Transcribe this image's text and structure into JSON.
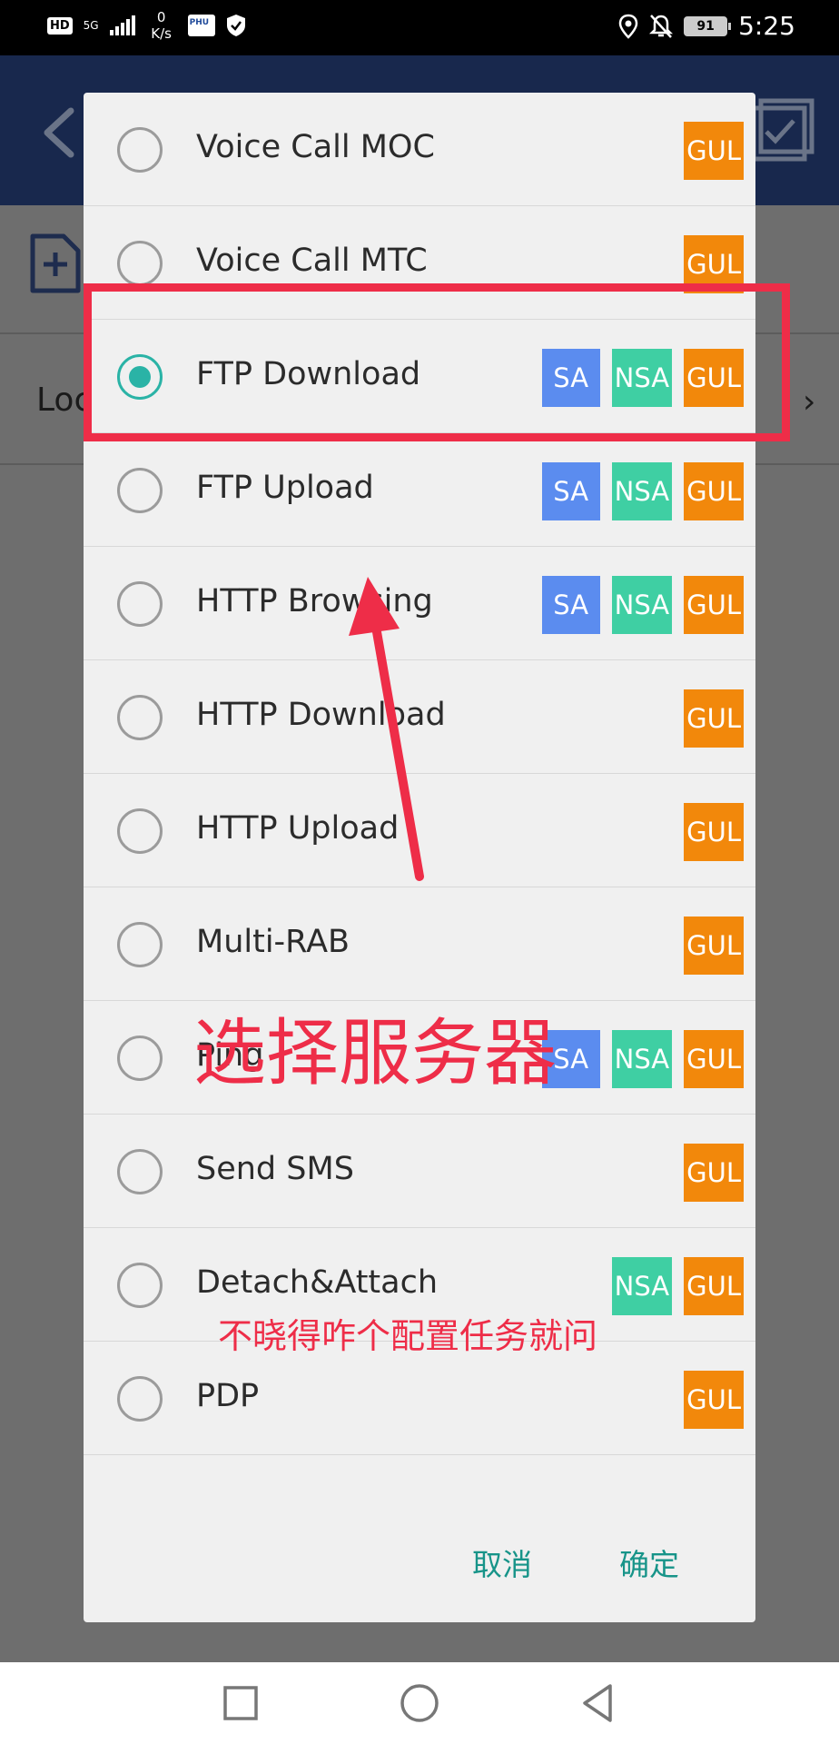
{
  "status_bar": {
    "hd": "HD",
    "network": "5G",
    "speed_value": "0",
    "speed_unit": "K/s",
    "app_badge": "PHU",
    "battery": "91",
    "time": "5:25"
  },
  "background": {
    "row_label_partial": "Loc"
  },
  "dialog": {
    "items": [
      {
        "label": "Voice Call MOC",
        "selected": false,
        "badges": [
          "GUL"
        ]
      },
      {
        "label": "Voice Call MTC",
        "selected": false,
        "badges": [
          "GUL"
        ]
      },
      {
        "label": "FTP Download",
        "selected": true,
        "badges": [
          "SA",
          "NSA",
          "GUL"
        ]
      },
      {
        "label": "FTP Upload",
        "selected": false,
        "badges": [
          "SA",
          "NSA",
          "GUL"
        ]
      },
      {
        "label": "HTTP Browsing",
        "selected": false,
        "badges": [
          "SA",
          "NSA",
          "GUL"
        ]
      },
      {
        "label": "HTTP Download",
        "selected": false,
        "badges": [
          "GUL"
        ]
      },
      {
        "label": "HTTP Upload",
        "selected": false,
        "badges": [
          "GUL"
        ]
      },
      {
        "label": "Multi-RAB",
        "selected": false,
        "badges": [
          "GUL"
        ]
      },
      {
        "label": "Ping",
        "selected": false,
        "badges": [
          "SA",
          "NSA",
          "GUL"
        ]
      },
      {
        "label": "Send SMS",
        "selected": false,
        "badges": [
          "GUL"
        ]
      },
      {
        "label": "Detach&Attach",
        "selected": false,
        "badges": [
          "NSA",
          "GUL"
        ]
      },
      {
        "label": "PDP",
        "selected": false,
        "badges": [
          "GUL"
        ]
      }
    ],
    "cancel_label": "取消",
    "ok_label": "确定"
  },
  "annotations": {
    "big_text": "选择服务器",
    "small_text": "不晓得咋个配置任务就问",
    "color": "#ee2d48"
  },
  "colors": {
    "accent": "#179489",
    "radio_selected": "#2ab3a6",
    "sa": "#5b8cef",
    "nsa": "#3fcfa3",
    "gul": "#f2880b",
    "header": "#18284d"
  }
}
